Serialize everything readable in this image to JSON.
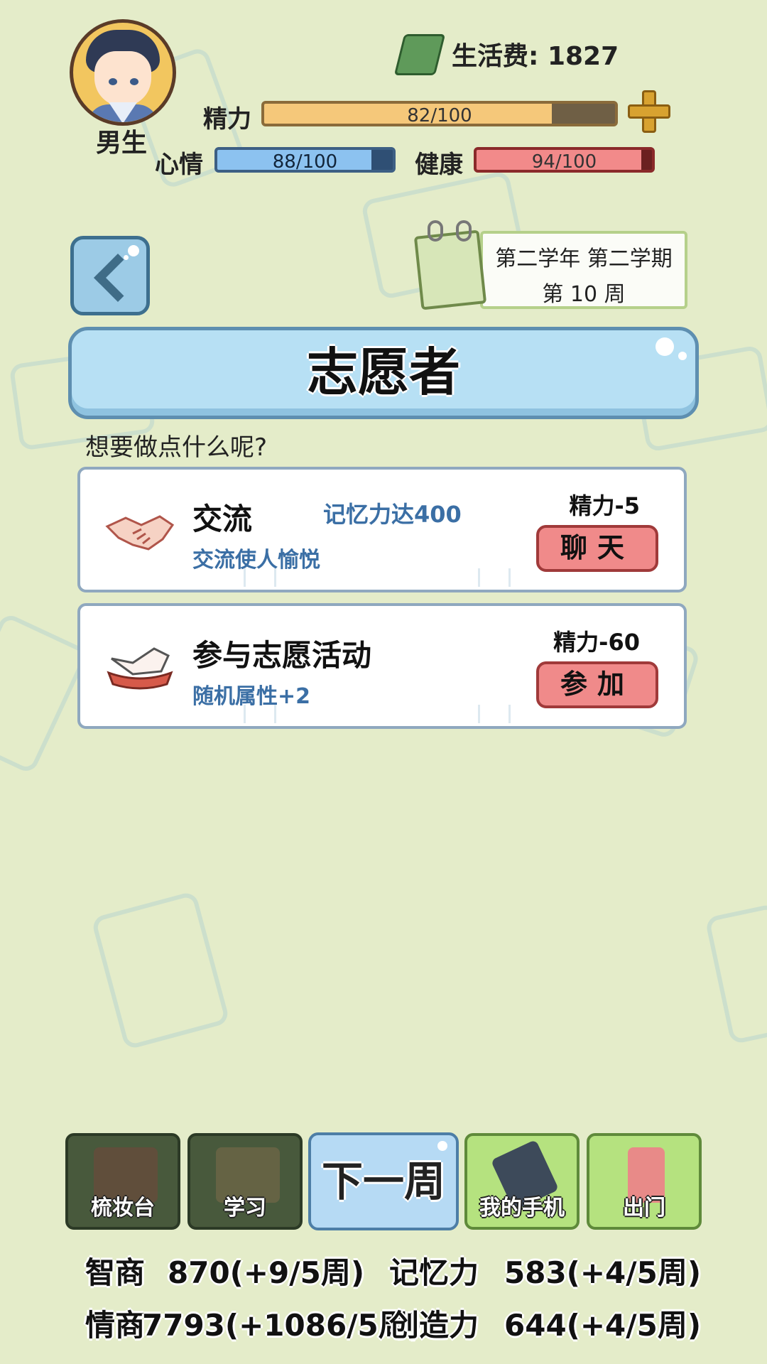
{
  "player": {
    "gender": "男生"
  },
  "money": {
    "label": "生活费:",
    "value": "1827"
  },
  "stats_bars": {
    "energy": {
      "label": "精力",
      "text": "82/100",
      "value": 82,
      "max": 100
    },
    "mood": {
      "label": "心情",
      "text": "88/100",
      "value": 88,
      "max": 100
    },
    "health": {
      "label": "健康",
      "text": "94/100",
      "value": 94,
      "max": 100
    }
  },
  "calendar": {
    "line1": "第二学年 第二学期",
    "line2": "第 10 周"
  },
  "page": {
    "title": "志愿者",
    "prompt": "想要做点什么呢?"
  },
  "activities": [
    {
      "name": "交流",
      "requirement": "记忆力达400",
      "description": "交流使人愉悦",
      "cost": "精力-5",
      "button": "聊天",
      "icon": "handshake-icon"
    },
    {
      "name": "参与志愿活动",
      "requirement": "",
      "description": "随机属性+2",
      "cost": "精力-60",
      "button": "参加",
      "icon": "volunteer-hand-icon"
    }
  ],
  "nav": {
    "vanity": "梳妆台",
    "study": "学习",
    "next_week": "下一周",
    "phone": "我的手机",
    "go_out": "出门"
  },
  "attributes": {
    "iq_label": "智商",
    "iq_value": "870(+9/5周)",
    "memory_label": "记忆力",
    "memory_value": "583(+4/5周)",
    "eq_label": "情商",
    "eq_value": "7793(+1086/5周)",
    "creativity_label": "创造力",
    "creativity_value": "644(+4/5周)"
  },
  "colors": {
    "background": "#e4ecc9",
    "energy_fill": "#f5c87a",
    "mood_fill": "#8cc2f0",
    "health_fill": "#f28a8a",
    "accent_blue": "#3b6fa5",
    "action_button": "#f08a8a"
  }
}
